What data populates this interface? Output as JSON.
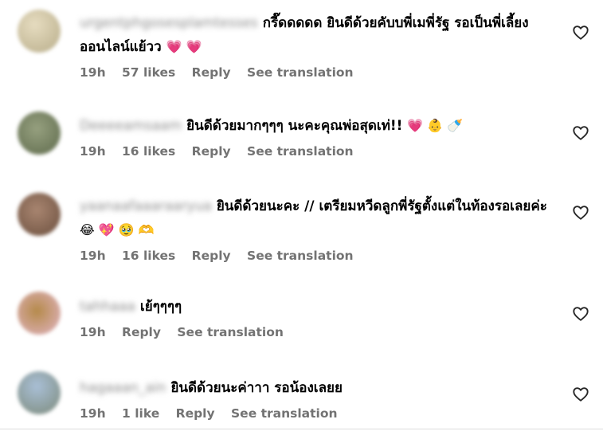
{
  "comments": [
    {
      "username": "urgentphgosesplamtesses",
      "text": "กรี๊ดดดดด ยินดีด้วยคับบพี่เมพี่รัฐ รอเป็นพี่เลี้ยงออนไลน์แย้วว",
      "emojis": "💗 💗",
      "time": "19h",
      "likes": "57 likes",
      "reply": "Reply",
      "translate": "See translation",
      "avatar_color": "#cfc6a6"
    },
    {
      "username": "Deeeeamsaam",
      "text": "ยินดีด้วยมากๆๆๆ นะคะคุณพ่อสุดเท่!!",
      "emojis": "💗 👶 🍼",
      "time": "19h",
      "likes": "16 likes",
      "reply": "Reply",
      "translate": "See translation",
      "avatar_color": "#7d8a6a"
    },
    {
      "username": "yaanaafaaaraaryua",
      "text": "ยินดีด้วยนะคะ // เตรียมหวีดลูกพี่รัฐตั้งแต่ในท้องรอเลยค่ะ",
      "emojis": "😂 💖 🥹 🫶",
      "time": "19h",
      "likes": "16 likes",
      "reply": "Reply",
      "translate": "See translation",
      "avatar_color": "#8a6b55"
    },
    {
      "username": "tahhaaa",
      "text": "เย้ๆๆๆๆ",
      "emojis": "",
      "time": "19h",
      "likes": "",
      "reply": "Reply",
      "translate": "See translation",
      "avatar_color": "#c99a5a"
    },
    {
      "username": "hagaaan_ain",
      "text": "ยินดีด้วยนะค่าาา รอน้องเลยย",
      "emojis": "",
      "time": "19h",
      "likes": "1 like",
      "reply": "Reply",
      "translate": "See translation",
      "avatar_color": "#8aa0b6"
    }
  ],
  "icons": {
    "like": "heart-outline-icon"
  }
}
